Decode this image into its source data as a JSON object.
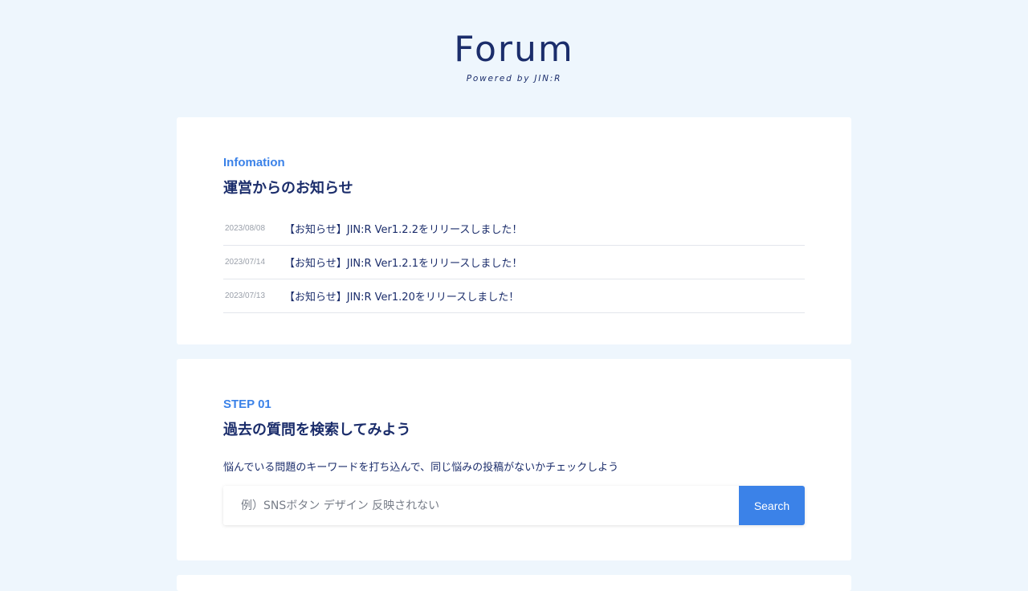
{
  "header": {
    "logo_text": "Forum",
    "logo_subtitle": "Powered by JIN:R"
  },
  "info": {
    "eyebrow": "Infomation",
    "title": "運営からのお知らせ",
    "items": [
      {
        "date": "2023/08/08",
        "title": "【お知らせ】JIN:R Ver1.2.2をリリースしました！"
      },
      {
        "date": "2023/07/14",
        "title": "【お知らせ】JIN:R Ver1.2.1をリリースしました！"
      },
      {
        "date": "2023/07/13",
        "title": "【お知らせ】JIN:R Ver1.20をリリースしました！"
      }
    ]
  },
  "step": {
    "eyebrow": "STEP 01",
    "title": "過去の質問を検索してみよう",
    "description": "悩んでいる問題のキーワードを打ち込んで、同じ悩みの投稿がないかチェックしよう",
    "search_placeholder": "例）SNSボタン デザイン 反映されない",
    "search_value": "",
    "search_button": "Search"
  },
  "colors": {
    "background": "#eef6fd",
    "accent": "#3b82e8",
    "navy": "#1b2d6b"
  }
}
